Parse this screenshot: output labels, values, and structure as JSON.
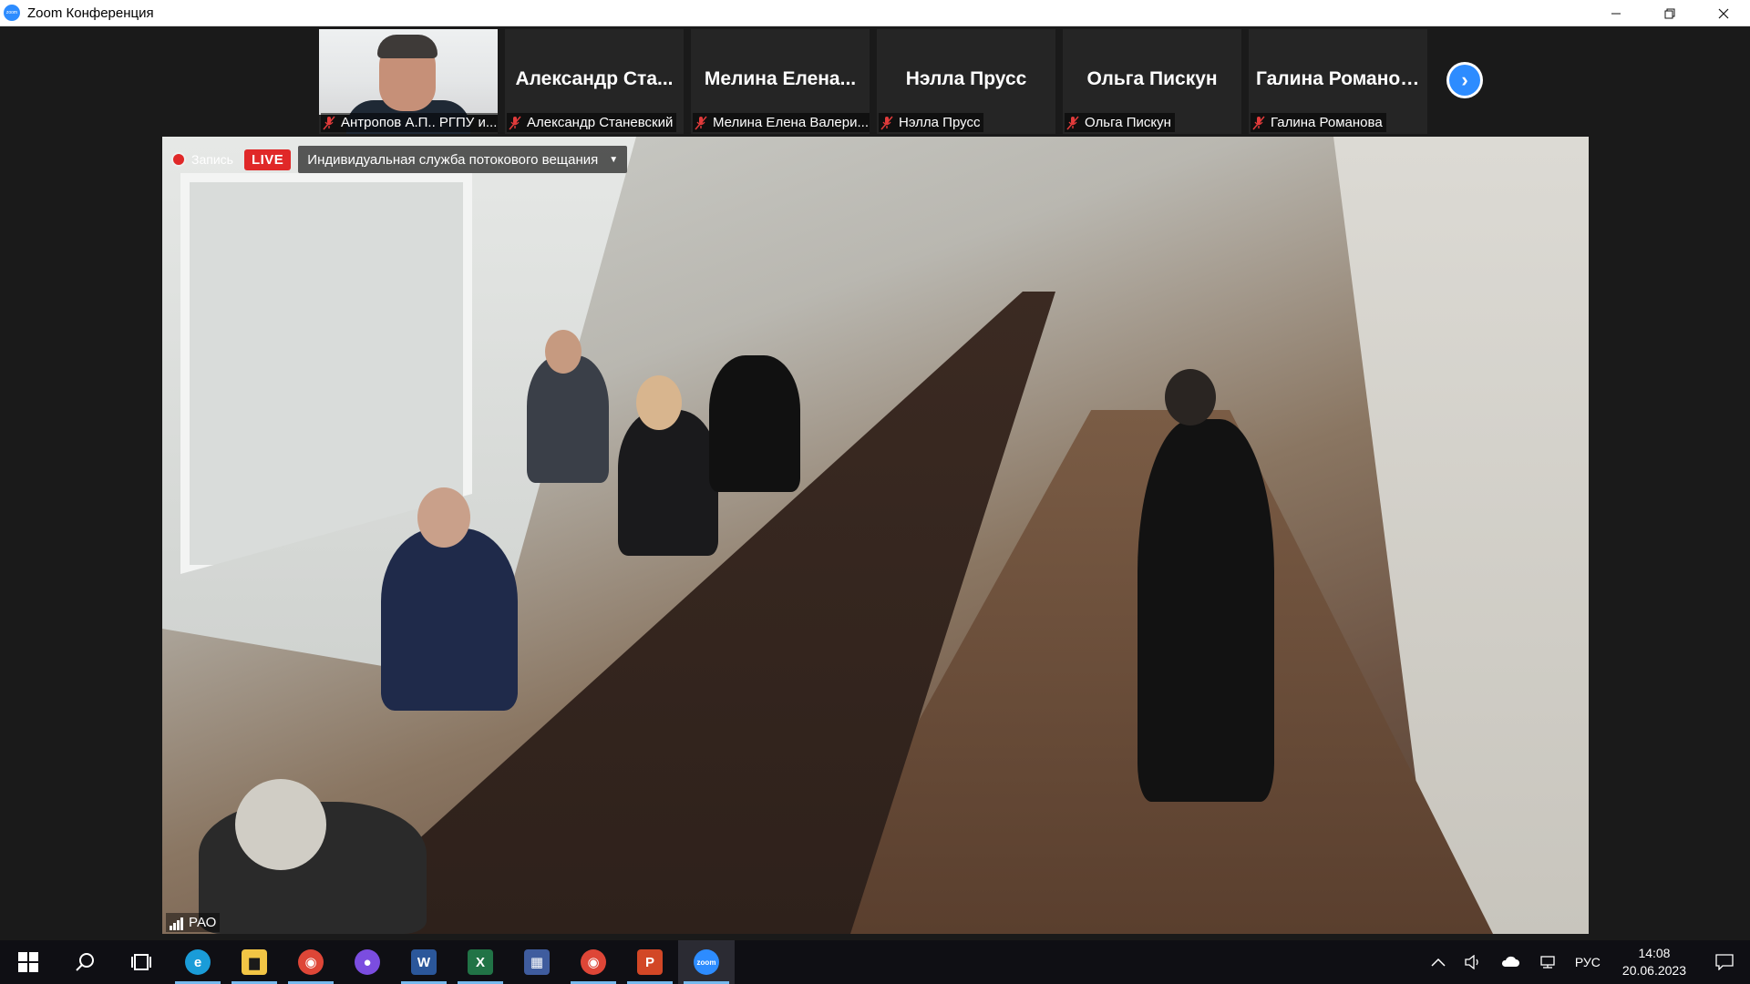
{
  "window": {
    "title": "Zoom Конференция",
    "app_icon": "zoom-logo-icon",
    "app_icon_text": "zoom",
    "controls": [
      "minimize-icon",
      "restore-icon",
      "close-icon"
    ]
  },
  "gallery": {
    "participants": [
      {
        "display_name": "",
        "nameplate": "Антропов А.П.. РГПУ и...",
        "muted": true,
        "has_video": true
      },
      {
        "display_name": "Александр Ста...",
        "nameplate": "Александр Станевский",
        "muted": true,
        "has_video": false
      },
      {
        "display_name": "Мелина Елена...",
        "nameplate": "Мелина Елена Валери...",
        "muted": true,
        "has_video": false
      },
      {
        "display_name": "Нэлла Прусс",
        "nameplate": "Нэлла Прусс",
        "muted": true,
        "has_video": false
      },
      {
        "display_name": "Ольга Пискун",
        "nameplate": "Ольга Пискун",
        "muted": true,
        "has_video": false
      },
      {
        "display_name": "Галина Романова",
        "nameplate": "Галина Романова",
        "muted": true,
        "has_video": false
      }
    ],
    "next_page_icon": "chevron-right-icon",
    "next_page_glyph": "›"
  },
  "main_video": {
    "recording_label": "Запись",
    "live_badge": "LIVE",
    "stream_service": "Индивидуальная служба потокового вещания",
    "stream_caret": "▼",
    "speaker_label": "РАО"
  },
  "taskbar": {
    "apps": [
      {
        "name": "start-button",
        "glyph": "⊞",
        "color": "#0f0f14"
      },
      {
        "name": "search-button",
        "glyph": "⌕",
        "color": "#0f0f14"
      },
      {
        "name": "task-view-button",
        "glyph": "⧉",
        "color": "#0f0f14"
      },
      {
        "name": "edge-app",
        "glyph": "e",
        "color": "#1a9cd8"
      },
      {
        "name": "explorer-app",
        "glyph": "▆",
        "color": "#f2c545"
      },
      {
        "name": "chrome-app",
        "glyph": "◉",
        "color": "#de4637"
      },
      {
        "name": "pages-app",
        "glyph": "●",
        "color": "#7b4de0"
      },
      {
        "name": "word-app",
        "glyph": "W",
        "color": "#2b579a"
      },
      {
        "name": "excel-app",
        "glyph": "X",
        "color": "#217346"
      },
      {
        "name": "calculator-app",
        "glyph": "▦",
        "color": "#3f5c9e"
      },
      {
        "name": "chrome-profile-app",
        "glyph": "◉",
        "color": "#de4637"
      },
      {
        "name": "powerpoint-app",
        "glyph": "P",
        "color": "#d24726"
      },
      {
        "name": "zoom-app",
        "glyph": "zoom",
        "color": "#2d8cff"
      }
    ],
    "tray": {
      "overflow_glyph": "^",
      "volume_glyph": "🕪",
      "cloud_glyph": "☁",
      "network_glyph": "▭",
      "language": "РУС",
      "time": "14:08",
      "date": "20.06.2023",
      "notifications_glyph": "▢"
    }
  }
}
